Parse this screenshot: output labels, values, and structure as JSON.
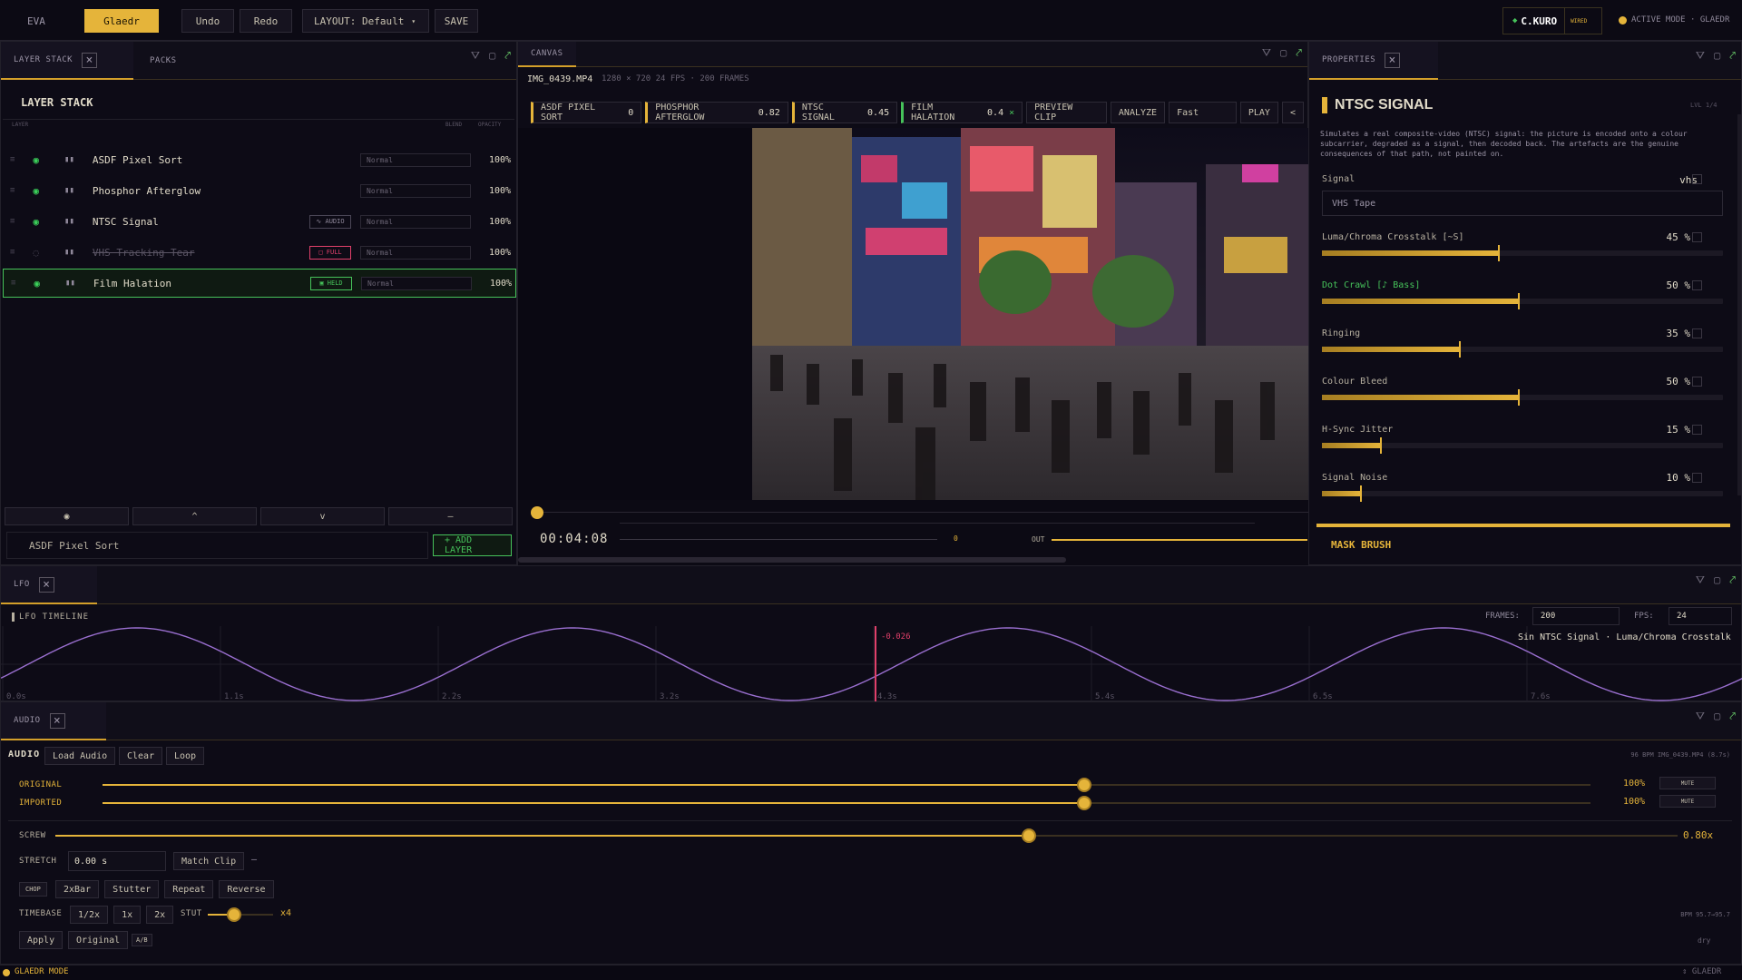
{
  "topbar": {
    "eva": "EVA",
    "gladr": "Glaedr",
    "undo": "Undo",
    "redo": "Redo",
    "layout": "LAYOUT: Default",
    "save": "SAVE",
    "user": "C.KURO",
    "wired": "WIRED",
    "active_mode": "ACTIVE MODE · GLAEDR"
  },
  "left": {
    "tab_layer": "LAYER STACK",
    "tab_packs": "PACKS",
    "title": "LAYER STACK",
    "col_layer": "LAYER",
    "col_blend": "BLEND",
    "col_opacity": "OPACITY",
    "layers": [
      {
        "name": "ASDF Pixel Sort",
        "blend": "Normal",
        "opacity": "100%",
        "tag": ""
      },
      {
        "name": "Phosphor Afterglow",
        "blend": "Normal",
        "opacity": "100%",
        "tag": ""
      },
      {
        "name": "NTSC Signal",
        "blend": "Normal",
        "opacity": "100%",
        "tag": "AUDIO"
      },
      {
        "name": "VHS Tracking Tear",
        "blend": "Normal",
        "opacity": "100%",
        "tag": "FULL"
      },
      {
        "name": "Film Halation",
        "blend": "Normal",
        "opacity": "100%",
        "tag": "HELD"
      }
    ],
    "footer_btns": [
      "◉",
      "^",
      "v",
      "–"
    ],
    "selected_layer": "ASDF Pixel Sort",
    "add_layer": "+ ADD LAYER"
  },
  "canvas": {
    "tab": "CANVAS",
    "file": "IMG_0439.MP4",
    "meta": "1280 × 720  24 FPS · 200 FRAMES",
    "chips": [
      {
        "label": "ASDF PIXEL SORT",
        "val": "0"
      },
      {
        "label": "PHOSPHOR AFTERGLOW",
        "val": "0.82"
      },
      {
        "label": "NTSC SIGNAL",
        "val": "0.45"
      },
      {
        "label": "FILM HALATION",
        "val": "0.4"
      }
    ],
    "preview": "PREVIEW CLIP",
    "analyze": "ANALYZE",
    "fast": "Fast",
    "play": "PLAY",
    "lt": "<",
    "timecode": "00:04:08",
    "in_val": "0",
    "out_label": "OUT"
  },
  "props": {
    "tab": "PROPERTIES",
    "title": "NTSC SIGNAL",
    "ver": "LVL 1/4",
    "desc": "Simulates a real composite-video (NTSC) signal: the picture is encoded onto a colour subcarrier, degraded as a signal, then decoded back. The artefacts are the genuine consequences of that path, not painted on.",
    "signal_label": "Signal",
    "signal_val": "vhs",
    "signal_select": "VHS Tape",
    "params": [
      {
        "label": "Luma/Chroma Crosstalk  [~S]",
        "val": "45 %",
        "pct": 45,
        "highlight": false
      },
      {
        "label": "Dot Crawl  [♪ Bass]",
        "val": "50 %",
        "pct": 50,
        "highlight": true
      },
      {
        "label": "Ringing",
        "val": "35 %",
        "pct": 35,
        "highlight": false
      },
      {
        "label": "Colour Bleed",
        "val": "50 %",
        "pct": 50,
        "highlight": false
      },
      {
        "label": "H-Sync Jitter",
        "val": "15 %",
        "pct": 15,
        "highlight": false
      },
      {
        "label": "Signal Noise",
        "val": "10 %",
        "pct": 10,
        "highlight": false
      }
    ],
    "mask": "MASK BRUSH"
  },
  "lfo": {
    "tab": "LFO",
    "title": "LFO TIMELINE",
    "frames_label": "FRAMES:",
    "frames": "200",
    "fps_label": "FPS:",
    "fps": "24",
    "marker": "-0.026",
    "target": "Sin  NTSC Signal · Luma/Chroma Crosstalk",
    "ticks": [
      "0.0s",
      "1.1s",
      "2.2s",
      "3.2s",
      "4.3s",
      "5.4s",
      "6.5s",
      "7.6s"
    ],
    "playhead": 0.4
  },
  "audio": {
    "tab": "AUDIO",
    "title": "AUDIO",
    "load": "Load Audio",
    "clear": "Clear",
    "loop": "Loop",
    "info": "96 BPM IMG_0439.MP4  (8.7s)",
    "original": "ORIGINAL",
    "imported": "IMPORTED",
    "orig_pct": "100%",
    "imp_pct": "100%",
    "mute": "MUTE",
    "orig_level": 0.66,
    "imp_level": 0.66,
    "screw": "SCREW",
    "screw_val": "0.80x",
    "screw_level": 0.6,
    "stretch": "STRETCH",
    "stretch_val": "0.00 s",
    "match": "Match Clip",
    "dash": "–",
    "chop": "CHOP",
    "chop_btns": [
      "2xBar",
      "Stutter",
      "Repeat",
      "Reverse"
    ],
    "timebase": "TIMEBASE",
    "tb_btns": [
      "1/2x",
      "1x",
      "2x"
    ],
    "stut": "STUT",
    "stut_val": "x4",
    "stut_level": 0.4,
    "bpm_range": "BPM 95.7→95.7",
    "apply": "Apply",
    "orig_btn": "Original",
    "ab": "A/B",
    "dry": "dry"
  },
  "status": {
    "left": "GLAEDR MODE",
    "right": "⇕ GLAEDR"
  },
  "colors": {
    "accent": "#e5b43a",
    "green": "#46c25a",
    "red": "#e0406a",
    "purple": "#9a6fd0"
  }
}
